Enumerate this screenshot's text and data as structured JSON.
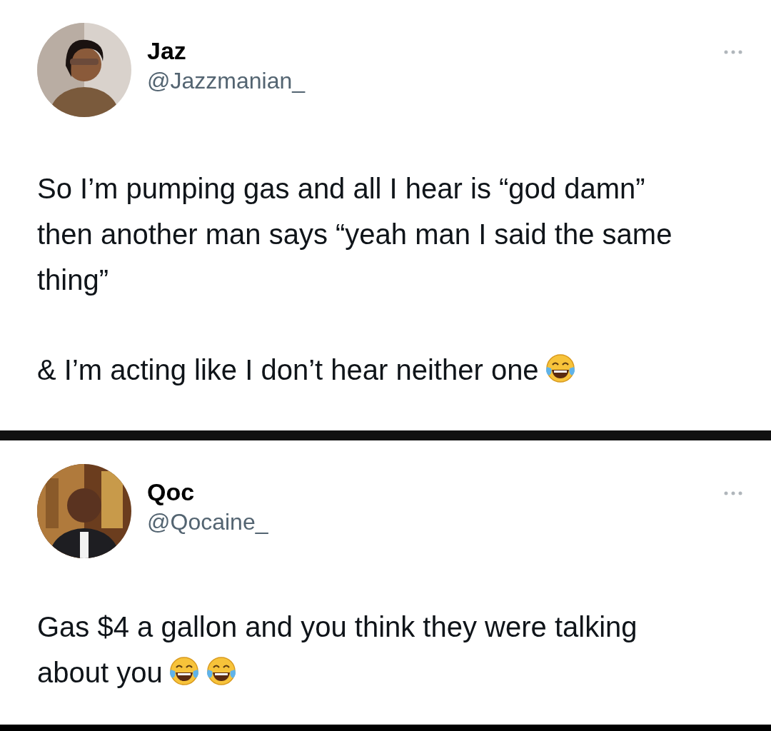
{
  "tweets": [
    {
      "name": "Jaz",
      "handle": "@Jazzmanian_",
      "paragraphs": [
        {
          "text": "So I’m pumping gas and all I hear is “god damn” then another man says “yeah man I said the same thing”"
        },
        {
          "text": "& I’m acting like I don’t hear neither one",
          "emojis": [
            {
              "kind": "laughing"
            }
          ]
        }
      ]
    },
    {
      "name": "Qoc",
      "handle": "@Qocaine_",
      "paragraphs": [
        {
          "text": "Gas $4 a gallon and you think they were talking about you",
          "emojis": [
            {
              "kind": "laughing"
            },
            {
              "kind": "laughing"
            }
          ]
        }
      ]
    }
  ]
}
